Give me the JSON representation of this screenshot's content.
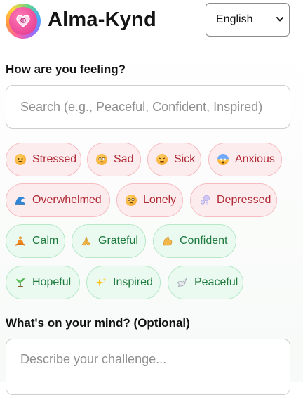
{
  "header": {
    "title": "Alma-Kynd",
    "language": {
      "selected": "English"
    }
  },
  "feeling": {
    "question": "How are you feeling?",
    "search_placeholder": "Search (e.g., Peaceful, Confident, Inspired)",
    "moods": [
      {
        "label": "Stressed",
        "icon": "stressed-face-icon",
        "tone": "negative"
      },
      {
        "label": "Sad",
        "icon": "sad-face-icon",
        "tone": "negative"
      },
      {
        "label": "Sick",
        "icon": "sick-face-icon",
        "tone": "negative"
      },
      {
        "label": "Anxious",
        "icon": "anxious-face-icon",
        "tone": "negative"
      },
      {
        "label": "Overwhelmed",
        "icon": "wave-icon",
        "tone": "negative"
      },
      {
        "label": "Lonely",
        "icon": "lonely-face-icon",
        "tone": "negative"
      },
      {
        "label": "Depressed",
        "icon": "bubbles-icon",
        "tone": "negative"
      },
      {
        "label": "Calm",
        "icon": "meditation-icon",
        "tone": "positive"
      },
      {
        "label": "Grateful",
        "icon": "praying-hands-icon",
        "tone": "positive"
      },
      {
        "label": "Confident",
        "icon": "flexed-biceps-icon",
        "tone": "positive"
      },
      {
        "label": "Hopeful",
        "icon": "seedling-icon",
        "tone": "positive"
      },
      {
        "label": "Inspired",
        "icon": "sparkles-icon",
        "tone": "positive"
      },
      {
        "label": "Peaceful",
        "icon": "dove-icon",
        "tone": "positive"
      }
    ]
  },
  "mind": {
    "question": "What's on your mind? (Optional)",
    "placeholder": "Describe your challenge..."
  },
  "colors": {
    "negative_bg": "#fdeced",
    "negative_border": "#f6bcc0",
    "negative_text": "#b02a37",
    "positive_bg": "#eafaf0",
    "positive_border": "#b4e8c6",
    "positive_text": "#1f7a3e"
  }
}
